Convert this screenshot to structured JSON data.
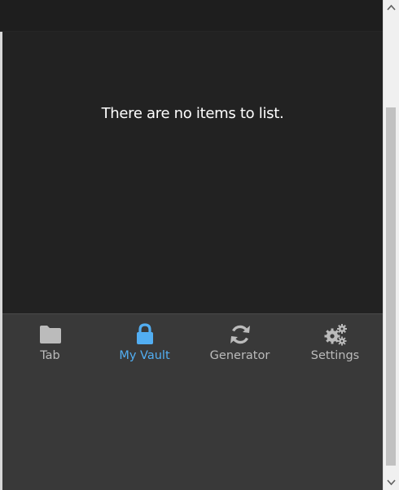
{
  "content": {
    "empty_message": "There are no items to list."
  },
  "tabs": [
    {
      "id": "tab",
      "label": "Tab",
      "icon": "folder-icon",
      "active": false
    },
    {
      "id": "vault",
      "label": "My Vault",
      "icon": "lock-icon",
      "active": true
    },
    {
      "id": "generator",
      "label": "Generator",
      "icon": "refresh-icon",
      "active": false
    },
    {
      "id": "settings",
      "label": "Settings",
      "icon": "gears-icon",
      "active": false
    }
  ],
  "colors": {
    "background": "#222222",
    "tabbar_background": "#393939",
    "tab_inactive": "#bbbbbb",
    "tab_active": "#52aef2",
    "text": "#ffffff"
  }
}
